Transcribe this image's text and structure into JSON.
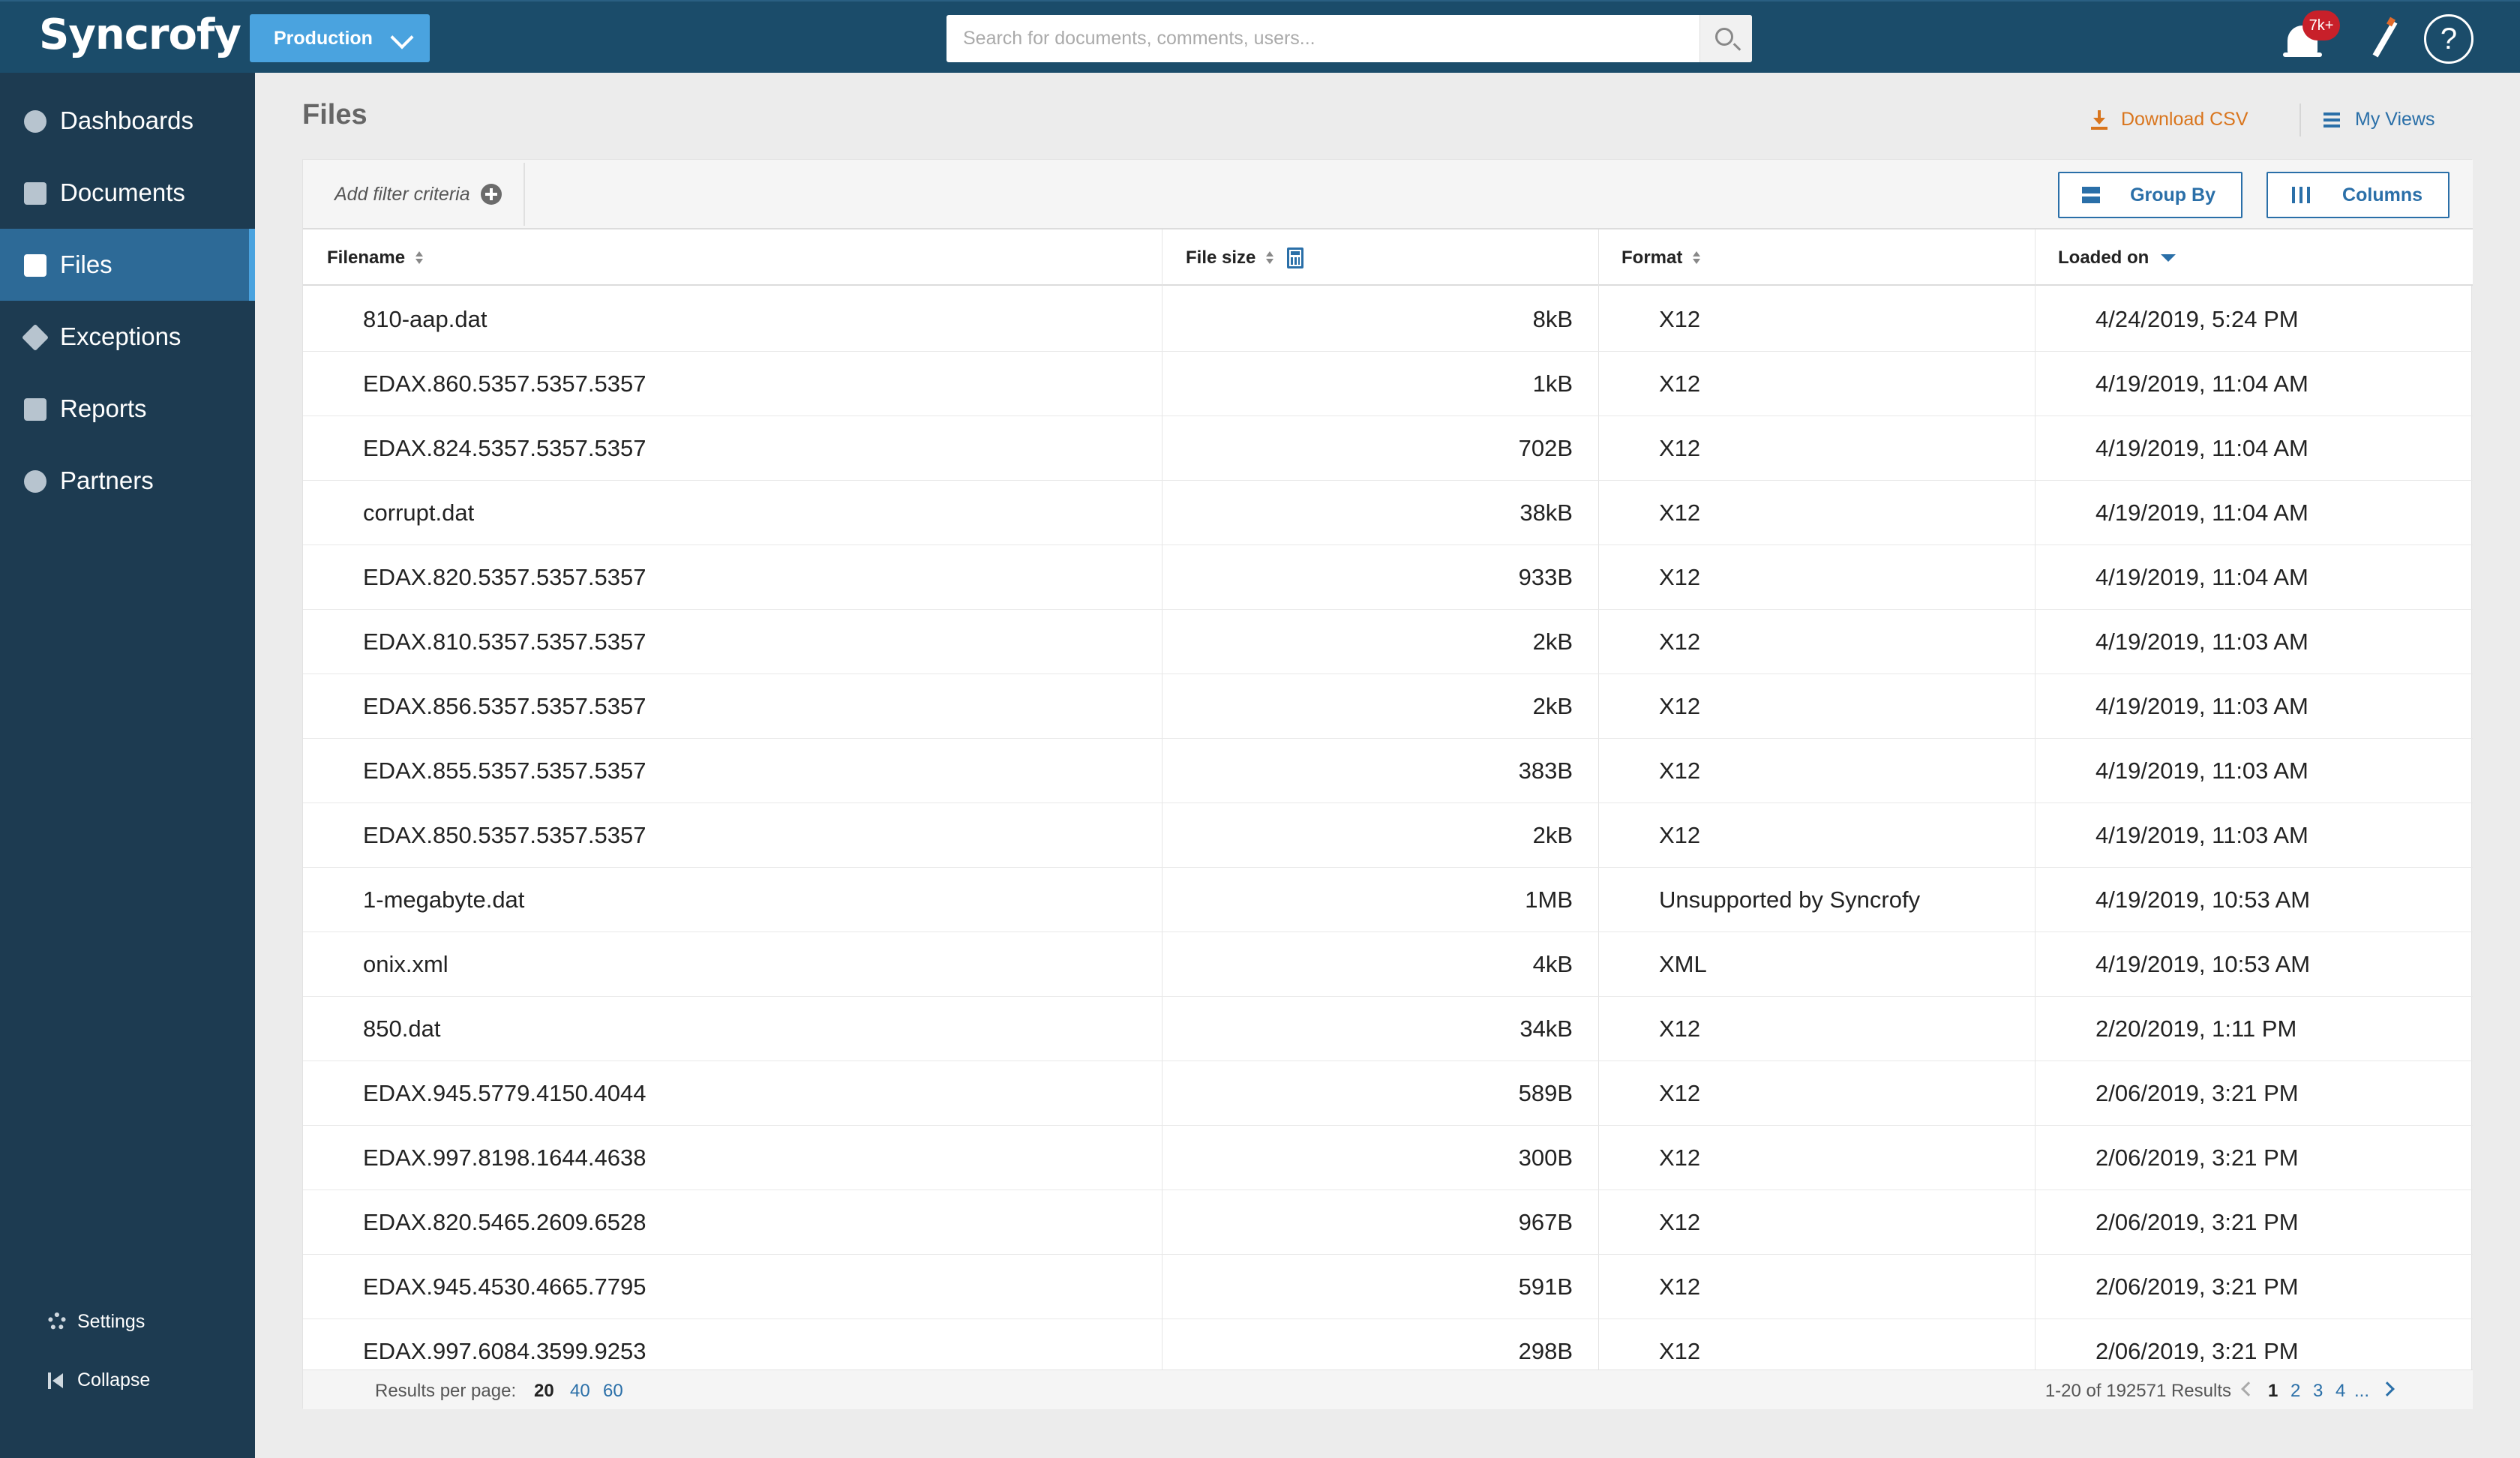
{
  "app": {
    "logo": "Syncrofy",
    "environment": "Production"
  },
  "search": {
    "placeholder": "Search for documents, comments, users..."
  },
  "notifications": {
    "badge": "7k+"
  },
  "help": {
    "label": "?"
  },
  "sidebar": {
    "items": [
      {
        "label": "Dashboards",
        "icon": "dashboard-icon"
      },
      {
        "label": "Documents",
        "icon": "documents-icon"
      },
      {
        "label": "Files",
        "icon": "folder-icon",
        "active": true
      },
      {
        "label": "Exceptions",
        "icon": "exception-icon"
      },
      {
        "label": "Reports",
        "icon": "reports-icon"
      },
      {
        "label": "Partners",
        "icon": "partners-icon"
      }
    ],
    "settings_label": "Settings",
    "collapse_label": "Collapse"
  },
  "page": {
    "title": "Files",
    "download_csv": "Download CSV",
    "my_views": "My Views"
  },
  "toolbar": {
    "add_filter": "Add filter criteria",
    "group_by": "Group By",
    "columns": "Columns"
  },
  "table": {
    "headers": {
      "filename": "Filename",
      "file_size": "File size",
      "format": "Format",
      "loaded_on": "Loaded on"
    },
    "rows": [
      {
        "filename": "810-aap.dat",
        "size": "8kB",
        "format": "X12",
        "loaded": "4/24/2019, 5:24 PM"
      },
      {
        "filename": "EDAX.860.5357.5357.5357",
        "size": "1kB",
        "format": "X12",
        "loaded": "4/19/2019, 11:04 AM"
      },
      {
        "filename": "EDAX.824.5357.5357.5357",
        "size": "702B",
        "format": "X12",
        "loaded": "4/19/2019, 11:04 AM"
      },
      {
        "filename": "corrupt.dat",
        "size": "38kB",
        "format": "X12",
        "loaded": "4/19/2019, 11:04 AM"
      },
      {
        "filename": "EDAX.820.5357.5357.5357",
        "size": "933B",
        "format": "X12",
        "loaded": "4/19/2019, 11:04 AM"
      },
      {
        "filename": "EDAX.810.5357.5357.5357",
        "size": "2kB",
        "format": "X12",
        "loaded": "4/19/2019, 11:03 AM"
      },
      {
        "filename": "EDAX.856.5357.5357.5357",
        "size": "2kB",
        "format": "X12",
        "loaded": "4/19/2019, 11:03 AM"
      },
      {
        "filename": "EDAX.855.5357.5357.5357",
        "size": "383B",
        "format": "X12",
        "loaded": "4/19/2019, 11:03 AM"
      },
      {
        "filename": "EDAX.850.5357.5357.5357",
        "size": "2kB",
        "format": "X12",
        "loaded": "4/19/2019, 11:03 AM"
      },
      {
        "filename": "1-megabyte.dat",
        "size": "1MB",
        "format": "Unsupported by Syncrofy",
        "loaded": "4/19/2019, 10:53 AM"
      },
      {
        "filename": "onix.xml",
        "size": "4kB",
        "format": "XML",
        "loaded": "4/19/2019, 10:53 AM"
      },
      {
        "filename": "850.dat",
        "size": "34kB",
        "format": "X12",
        "loaded": "2/20/2019, 1:11 PM"
      },
      {
        "filename": "EDAX.945.5779.4150.4044",
        "size": "589B",
        "format": "X12",
        "loaded": "2/06/2019, 3:21 PM"
      },
      {
        "filename": "EDAX.997.8198.1644.4638",
        "size": "300B",
        "format": "X12",
        "loaded": "2/06/2019, 3:21 PM"
      },
      {
        "filename": "EDAX.820.5465.2609.6528",
        "size": "967B",
        "format": "X12",
        "loaded": "2/06/2019, 3:21 PM"
      },
      {
        "filename": "EDAX.945.4530.4665.7795",
        "size": "591B",
        "format": "X12",
        "loaded": "2/06/2019, 3:21 PM"
      },
      {
        "filename": "EDAX.997.6084.3599.9253",
        "size": "298B",
        "format": "X12",
        "loaded": "2/06/2019, 3:21 PM"
      }
    ]
  },
  "pager": {
    "per_page_label": "Results per page:",
    "per_page_options": [
      "20",
      "40",
      "60"
    ],
    "results": "1-20 of 192571 Results",
    "pages": [
      "1",
      "2",
      "3",
      "4"
    ],
    "ellipsis": "..."
  },
  "colors": {
    "topbar": "#1b4c6a",
    "sidebar": "#1d3b51",
    "accent": "#4aa3df",
    "link": "#2a6fa8",
    "download": "#d9751d",
    "badge": "#c8202a"
  }
}
